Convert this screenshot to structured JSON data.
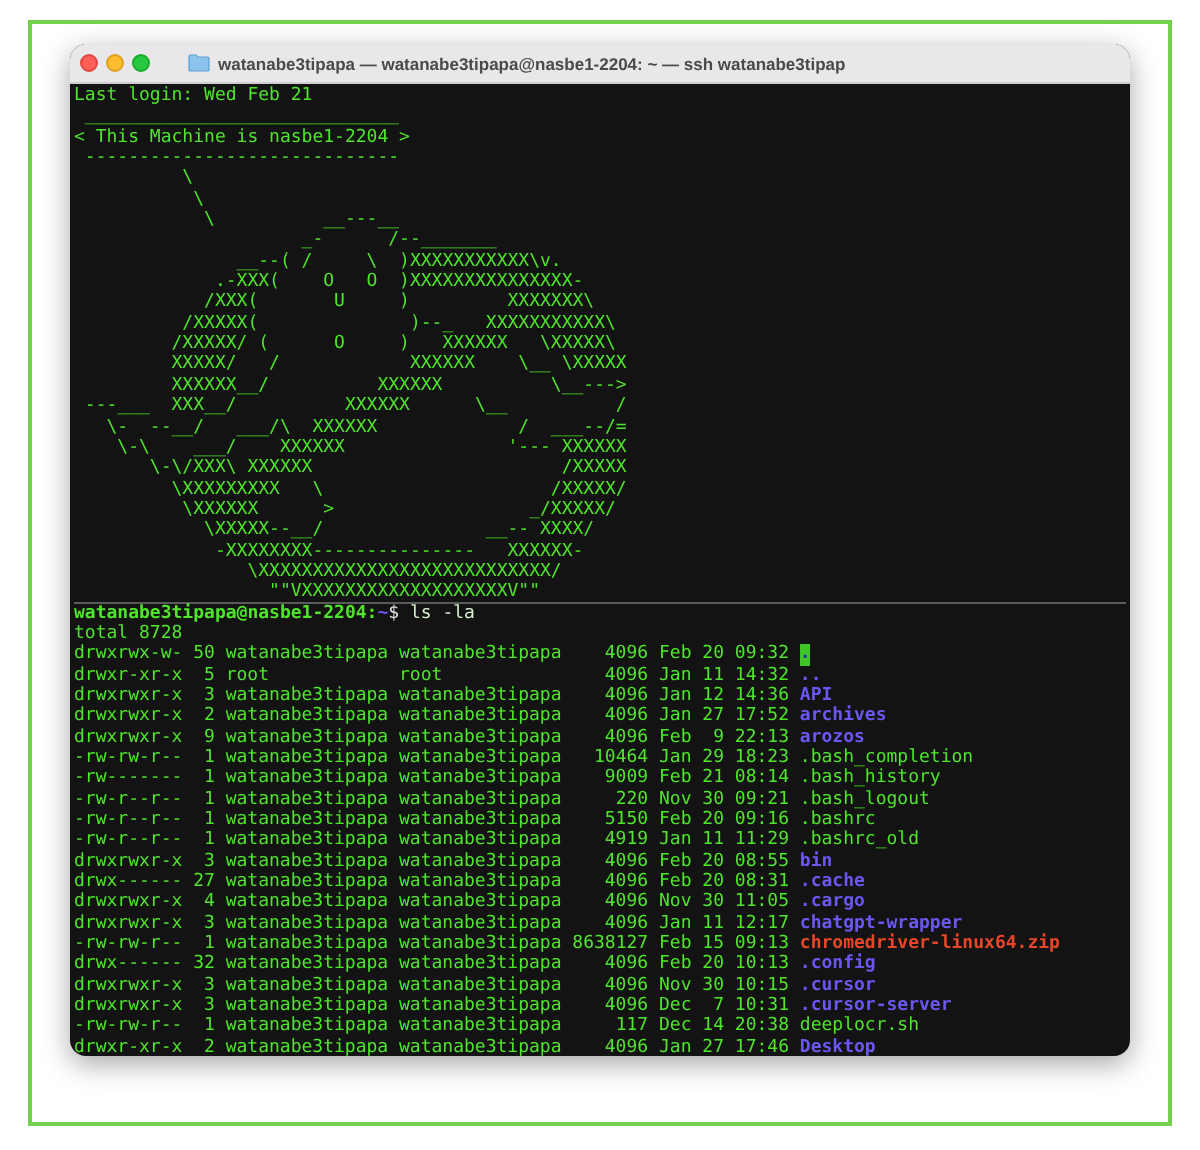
{
  "window": {
    "title": "watanabe3tipapa — watanabe3tipapa@nasbe1-2204: ~ — ssh watanabe3tipap"
  },
  "terminal": {
    "last_login": "Last login: Wed Feb 21",
    "banner": [
      " _____________________________",
      "< This Machine is nasbe1-2204 >",
      " -----------------------------"
    ],
    "art": [
      "          \\",
      "           \\",
      "            \\          __---__",
      "                     _-      /--_______",
      "               __--( /     \\  )XXXXXXXXXXX\\v.",
      "             .-XXX(    O   O  )XXXXXXXXXXXXXXX-",
      "            /XXX(       U     )         XXXXXXX\\",
      "          /XXXXX(              )--_   XXXXXXXXXXX\\",
      "         /XXXXX/ (      O     )   XXXXXX   \\XXXXX\\",
      "         XXXXX/   /            XXXXXX    \\__ \\XXXXX",
      "         XXXXXX__/          XXXXXX          \\__--->",
      " ---___  XXX__/          XXXXXX      \\__          /",
      "   \\-  --__/   ___/\\  XXXXXX             /  ___--/=",
      "    \\-\\    ___/    XXXXXX               '--- XXXXXX",
      "       \\-\\/XXX\\ XXXXXX                       /XXXXX",
      "         \\XXXXXXXXX   \\                     /XXXXX/",
      "          \\XXXXXX      >                  _/XXXXX/",
      "            \\XXXXX--__/               __-- XXXX/",
      "             -XXXXXXXX---------------   XXXXXX-",
      "                \\XXXXXXXXXXXXXXXXXXXXXXXXXXX/",
      "                  \"\"VXXXXXXXXXXXXXXXXXXXV\"\""
    ],
    "prompt": {
      "user_host": "watanabe3tipapa@nasbe1-2204:",
      "path": "~",
      "symbol": "$",
      "command": "ls -la"
    },
    "total": "total 8728",
    "listing": [
      {
        "permissions": "drwxrwx-w-",
        "links": "50",
        "owner": "watanabe3tipapa",
        "group": "watanabe3tipapa",
        "size": "4096",
        "modified": "Feb 20 09:32",
        "name": ".",
        "kind": "ow_dir"
      },
      {
        "permissions": "drwxr-xr-x",
        "links": "5",
        "owner": "root",
        "group": "root",
        "size": "4096",
        "modified": "Jan 11 14:32",
        "name": "..",
        "kind": "dir"
      },
      {
        "permissions": "drwxrwxr-x",
        "links": "3",
        "owner": "watanabe3tipapa",
        "group": "watanabe3tipapa",
        "size": "4096",
        "modified": "Jan 12 14:36",
        "name": "API",
        "kind": "dir"
      },
      {
        "permissions": "drwxrwxr-x",
        "links": "2",
        "owner": "watanabe3tipapa",
        "group": "watanabe3tipapa",
        "size": "4096",
        "modified": "Jan 27 17:52",
        "name": "archives",
        "kind": "dir"
      },
      {
        "permissions": "drwxrwxr-x",
        "links": "9",
        "owner": "watanabe3tipapa",
        "group": "watanabe3tipapa",
        "size": "4096",
        "modified": "Feb  9 22:13",
        "name": "arozos",
        "kind": "dir"
      },
      {
        "permissions": "-rw-rw-r--",
        "links": "1",
        "owner": "watanabe3tipapa",
        "group": "watanabe3tipapa",
        "size": "10464",
        "modified": "Jan 29 18:23",
        "name": ".bash_completion",
        "kind": "file"
      },
      {
        "permissions": "-rw-------",
        "links": "1",
        "owner": "watanabe3tipapa",
        "group": "watanabe3tipapa",
        "size": "9009",
        "modified": "Feb 21 08:14",
        "name": ".bash_history",
        "kind": "file"
      },
      {
        "permissions": "-rw-r--r--",
        "links": "1",
        "owner": "watanabe3tipapa",
        "group": "watanabe3tipapa",
        "size": "220",
        "modified": "Nov 30 09:21",
        "name": ".bash_logout",
        "kind": "file"
      },
      {
        "permissions": "-rw-r--r--",
        "links": "1",
        "owner": "watanabe3tipapa",
        "group": "watanabe3tipapa",
        "size": "5150",
        "modified": "Feb 20 09:16",
        "name": ".bashrc",
        "kind": "file"
      },
      {
        "permissions": "-rw-r--r--",
        "links": "1",
        "owner": "watanabe3tipapa",
        "group": "watanabe3tipapa",
        "size": "4919",
        "modified": "Jan 11 11:29",
        "name": ".bashrc_old",
        "kind": "file"
      },
      {
        "permissions": "drwxrwxr-x",
        "links": "3",
        "owner": "watanabe3tipapa",
        "group": "watanabe3tipapa",
        "size": "4096",
        "modified": "Feb 20 08:55",
        "name": "bin",
        "kind": "dir"
      },
      {
        "permissions": "drwx------",
        "links": "27",
        "owner": "watanabe3tipapa",
        "group": "watanabe3tipapa",
        "size": "4096",
        "modified": "Feb 20 08:31",
        "name": ".cache",
        "kind": "dir"
      },
      {
        "permissions": "drwxrwxr-x",
        "links": "4",
        "owner": "watanabe3tipapa",
        "group": "watanabe3tipapa",
        "size": "4096",
        "modified": "Nov 30 11:05",
        "name": ".cargo",
        "kind": "dir"
      },
      {
        "permissions": "drwxrwxr-x",
        "links": "3",
        "owner": "watanabe3tipapa",
        "group": "watanabe3tipapa",
        "size": "4096",
        "modified": "Jan 11 12:17",
        "name": "chatgpt-wrapper",
        "kind": "dir"
      },
      {
        "permissions": "-rw-rw-r--",
        "links": "1",
        "owner": "watanabe3tipapa",
        "group": "watanabe3tipapa",
        "size": "8638127",
        "modified": "Feb 15 09:13",
        "name": "chromedriver-linux64.zip",
        "kind": "archive"
      },
      {
        "permissions": "drwx------",
        "links": "32",
        "owner": "watanabe3tipapa",
        "group": "watanabe3tipapa",
        "size": "4096",
        "modified": "Feb 20 10:13",
        "name": ".config",
        "kind": "dir"
      },
      {
        "permissions": "drwxrwxr-x",
        "links": "3",
        "owner": "watanabe3tipapa",
        "group": "watanabe3tipapa",
        "size": "4096",
        "modified": "Nov 30 10:15",
        "name": ".cursor",
        "kind": "dir"
      },
      {
        "permissions": "drwxrwxr-x",
        "links": "3",
        "owner": "watanabe3tipapa",
        "group": "watanabe3tipapa",
        "size": "4096",
        "modified": "Dec  7 10:31",
        "name": ".cursor-server",
        "kind": "dir"
      },
      {
        "permissions": "-rw-rw-r--",
        "links": "1",
        "owner": "watanabe3tipapa",
        "group": "watanabe3tipapa",
        "size": "117",
        "modified": "Dec 14 20:38",
        "name": "deeplocr.sh",
        "kind": "file"
      },
      {
        "permissions": "drwxr-xr-x",
        "links": "2",
        "owner": "watanabe3tipapa",
        "group": "watanabe3tipapa",
        "size": "4096",
        "modified": "Jan 27 17:46",
        "name": "Desktop",
        "kind": "dir"
      }
    ]
  }
}
